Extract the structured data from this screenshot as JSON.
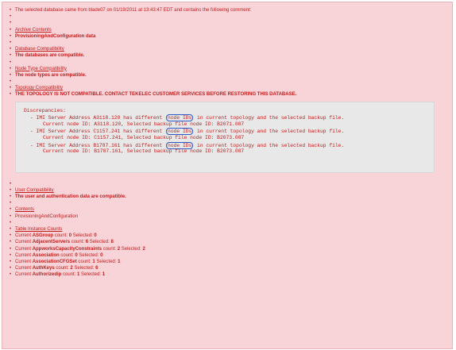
{
  "intro": "The selected database came from blade07 on 01/19/2011 at 13:43:47 EDT and contains the following comment:",
  "sections": [
    {
      "kind": "bullet",
      "text": ""
    },
    {
      "kind": "bullet",
      "text": ""
    },
    {
      "kind": "link",
      "text": "Archive Contents"
    },
    {
      "kind": "value",
      "text": "ProvisioningAndConfiguration data"
    },
    {
      "kind": "bullet",
      "text": ""
    },
    {
      "kind": "link",
      "text": "Database Compatibility"
    },
    {
      "kind": "value",
      "text": "The databases are compatible."
    },
    {
      "kind": "bullet",
      "text": ""
    },
    {
      "kind": "link",
      "text": "Node Type Compatibility"
    },
    {
      "kind": "value",
      "text": "The node types are compatible."
    },
    {
      "kind": "bullet",
      "text": ""
    },
    {
      "kind": "link",
      "text": "Topology Compatibility"
    },
    {
      "kind": "value",
      "text": "THE TOPOLOGY IS NOT COMPATIBLE. CONTACT TEKELEC CUSTOMER SERVICES BEFORE RESTORING THIS DATABASE."
    }
  ],
  "discrepancies": {
    "title": "Discrepancies:",
    "items": [
      {
        "line_a_prefix": "- IMI Server Address A3118.120 has different",
        "highlight": "node IDs",
        "line_a_suffix": "in current topology and the selected backup file.",
        "line_b": "Current node ID: A3118.120, Selected backup file node ID: B2071.087"
      },
      {
        "line_a_prefix": "- IMI Server Address C1157.241 has different",
        "highlight": "node IDs",
        "line_a_suffix": "in current topology and the selected backup file.",
        "line_b": "Current node ID: C1157.241, Selected backup file node ID: B2073.087"
      },
      {
        "line_a_prefix": "- IMI Server Address B1787.161 has different",
        "highlight": "node IDs",
        "line_a_suffix": "in current topology and the selected backup file.",
        "line_b": "Current node ID: B1787.161, Selected backup file node ID: B2073.087"
      }
    ]
  },
  "after": [
    {
      "kind": "bullet",
      "text": ""
    },
    {
      "kind": "link",
      "text": "User Compatibility"
    },
    {
      "kind": "value",
      "text": "The user and authentication data are compatible."
    },
    {
      "kind": "bullet",
      "text": ""
    },
    {
      "kind": "link",
      "text": "Contents"
    },
    {
      "kind": "plain",
      "text": "ProvisioningAndConfiguration"
    },
    {
      "kind": "bullet",
      "text": ""
    },
    {
      "kind": "link",
      "text": "Table Instance Counts"
    },
    {
      "kind": "count",
      "prefix": "Current ",
      "table": "ASGroup",
      "mid": " count: ",
      "count": "0",
      "sel": " Selected: ",
      "selcount": "0"
    },
    {
      "kind": "count",
      "prefix": "Current ",
      "table": "AdjacentServers",
      "mid": " count: ",
      "count": "6",
      "sel": " Selected: ",
      "selcount": "8"
    },
    {
      "kind": "count",
      "prefix": "Current ",
      "table": "AppworksCapacityConstraints",
      "mid": " count: ",
      "count": "2",
      "sel": " Selected: ",
      "selcount": "2"
    },
    {
      "kind": "count",
      "prefix": "Current ",
      "table": "Association",
      "mid": " count: ",
      "count": "0",
      "sel": " Selected: ",
      "selcount": "0"
    },
    {
      "kind": "count",
      "prefix": "Current ",
      "table": "AssociationCFGSet",
      "mid": " count: ",
      "count": "1",
      "sel": " Selected: ",
      "selcount": "1"
    },
    {
      "kind": "count",
      "prefix": "Current ",
      "table": "AuthKeys",
      "mid": " count: ",
      "count": "2",
      "sel": " Selected: ",
      "selcount": "6"
    },
    {
      "kind": "count",
      "prefix": "Current ",
      "table": "Authorizedip",
      "mid": " count: ",
      "count": "1",
      "sel": " Selected: ",
      "selcount": "1"
    }
  ]
}
